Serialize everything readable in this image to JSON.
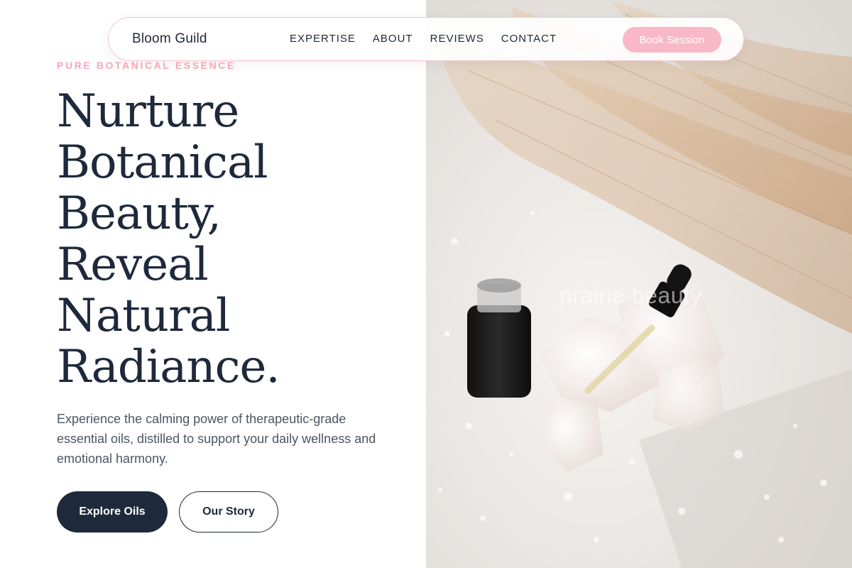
{
  "nav": {
    "brand": "Bloom Guild",
    "links": [
      "EXPERTISE",
      "ABOUT",
      "REVIEWS",
      "CONTACT"
    ],
    "cta_label": "Book Session"
  },
  "hero": {
    "eyebrow": "PURE BOTANICAL ESSENCE",
    "headline_lines": [
      "Nurture",
      "Botanical",
      "Beauty,",
      "Reveal",
      "Natural",
      "Radiance."
    ],
    "lead": "Experience the calming power of therapeutic-grade essential oils, distilled to support your daily wellness and emotional harmony.",
    "primary_label": "Explore Oils",
    "secondary_label": "Our Story"
  },
  "photo": {
    "watermark": "prairie beauty",
    "subject": "dropper-bottle-with-crystals-and-pampas-grass"
  },
  "colors": {
    "accent_pink": "#f9b8c8",
    "eyebrow_pink": "#f4a7b9",
    "navy": "#1e293b",
    "body_text": "#4b5563"
  }
}
